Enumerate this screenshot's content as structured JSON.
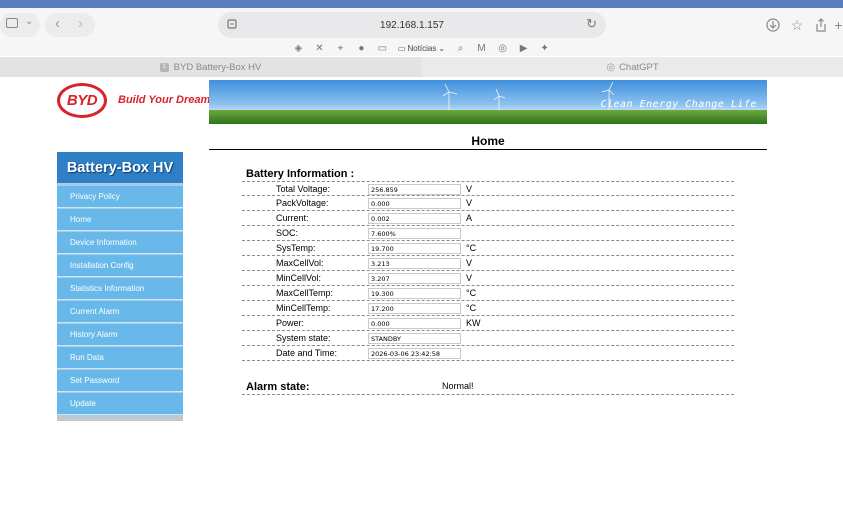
{
  "browser": {
    "address": "192.168.1.157",
    "favorites": {
      "news_label": "Notícias"
    },
    "tabs": [
      {
        "label": "BYD Battery-Box HV",
        "badge": "1"
      },
      {
        "label": "ChatGPT"
      }
    ]
  },
  "brand": {
    "logo_text": "BYD",
    "slogan": "Build Your Dreams",
    "banner_text": "Clean Energy Change Life"
  },
  "page": {
    "title": "Home"
  },
  "sidebar": {
    "title": "Battery-Box HV",
    "items": [
      {
        "label": "Privacy Policy"
      },
      {
        "label": "Home"
      },
      {
        "label": "Device Information"
      },
      {
        "label": "Installation Config"
      },
      {
        "label": "Statistics Information"
      },
      {
        "label": "Current Alarm"
      },
      {
        "label": "History Alarm"
      },
      {
        "label": "Run Data"
      },
      {
        "label": "Set Password"
      },
      {
        "label": "Update"
      }
    ]
  },
  "battery": {
    "heading": "Battery Information :",
    "rows": [
      {
        "label": "Total Voltage:",
        "value": "256.859",
        "unit": "V"
      },
      {
        "label": "PackVoltage:",
        "value": "0.000",
        "unit": "V"
      },
      {
        "label": "Current:",
        "value": "0.002",
        "unit": "A"
      },
      {
        "label": "SOC:",
        "value": "7.600%",
        "unit": ""
      },
      {
        "label": "SysTemp:",
        "value": "19.700",
        "unit": "°C"
      },
      {
        "label": "MaxCellVol:",
        "value": "3.213",
        "unit": "V"
      },
      {
        "label": "MinCellVol:",
        "value": "3.207",
        "unit": "V"
      },
      {
        "label": "MaxCellTemp:",
        "value": "19.300",
        "unit": "°C"
      },
      {
        "label": "MinCellTemp:",
        "value": "17.200",
        "unit": "°C"
      },
      {
        "label": "Power:",
        "value": "0.000",
        "unit": "KW"
      },
      {
        "label": "System state:",
        "value": "STANDBY",
        "unit": ""
      },
      {
        "label": "Date and Time:",
        "value": "2026-03-06 23:42:58",
        "unit": ""
      }
    ]
  },
  "alarm": {
    "label": "Alarm state:",
    "value": "Normal!"
  },
  "colors": {
    "brand_red": "#d8232a",
    "sidebar_blue": "#69b8ea",
    "sidebar_header": "#2e7fc6"
  }
}
